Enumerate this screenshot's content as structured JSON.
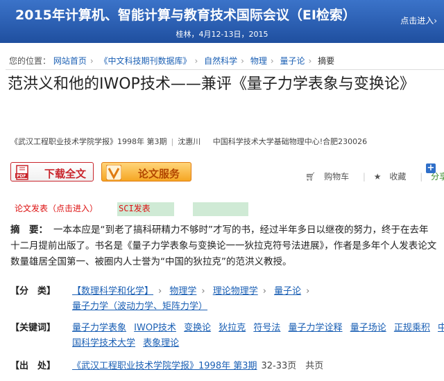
{
  "banner": {
    "title": "2015年计算机、智能计算与教育技术国际会议（EI检索）",
    "subtitle": "桂林，4月12-13日，2015",
    "enter": "点击进入›"
  },
  "breadcrumb": {
    "prefix": "您的位置：",
    "items": [
      "网站首页",
      "《中文科技期刊数据库》",
      "自然科学",
      "物理",
      "量子论"
    ],
    "current": "摘要"
  },
  "article": {
    "title": "范洪义和他的IWOP技术——兼评《量子力学表象与变换论》",
    "journal": "《武汉工程职业技术学院学报》1998年 第3期",
    "author": "沈惠川",
    "affiliation": "中国科学技术大学基础物理中心!合肥230026"
  },
  "actions": {
    "download": "下载全文",
    "service": "论文服务",
    "cart": "购物车",
    "favorite": "收藏",
    "share": "分享",
    "plus": "+"
  },
  "ads": {
    "left": "论文发表（点击进入）",
    "mid": "SCI发表"
  },
  "abstract": {
    "label": "摘　要：",
    "text": "一本本应是“到老了搞科研精力不够时”才写的书，经过半年多日以继夜的努力，终于在去年十二月提前出版了。书名是《量子力学表象与变换论一一狄拉克符号法进展》，作者是多年个人发表论文数量雄居全国第一、被圈内人士誉为“中国的狄拉克”的范洪义教授。"
  },
  "classification": {
    "label": "【分　类】",
    "items": [
      "【数理科学和化学】",
      "物理学",
      "理论物理学",
      "量子论",
      "量子力学（波动力学、矩阵力学）"
    ]
  },
  "keywords": {
    "label": "【关键词】",
    "items": [
      "量子力学表象",
      "IWOP技术",
      "变换论",
      "狄拉克",
      "符号法",
      "量子力学诠释",
      "量子场论",
      "正规乘积",
      "中国科学技术大学",
      "表象理论"
    ]
  },
  "origin": {
    "label": "【出　处】",
    "link": "《武汉工程职业技术学院学报》1998年 第3期",
    "pages": "32-33页　共页"
  },
  "colors": {
    "banner": "#2a5fb5",
    "link": "#1a5fb4",
    "ad_red": "#dd1111",
    "ad_green": "#cfead5"
  }
}
